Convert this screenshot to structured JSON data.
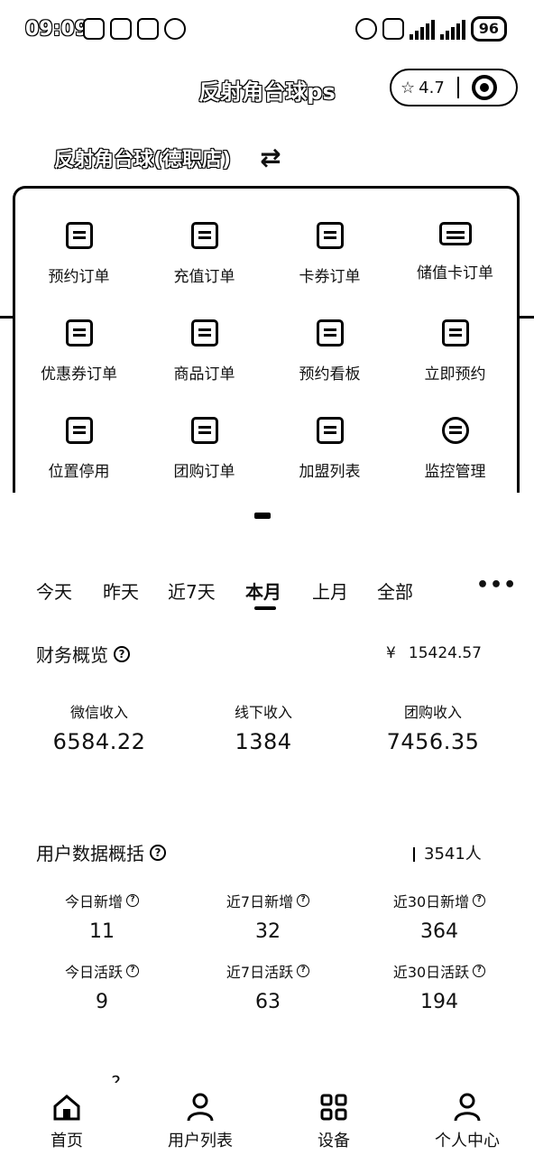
{
  "status_bar": {
    "time": "09:09",
    "battery": "96"
  },
  "header": {
    "title": "反射角台球ps",
    "rating": "4.7"
  },
  "store": {
    "name": "反射角台球(德职店)"
  },
  "grid": [
    {
      "label": "预约订单",
      "icon": "clipboard-icon"
    },
    {
      "label": "充值订单",
      "icon": "check-clipboard-icon"
    },
    {
      "label": "卡券订单",
      "icon": "ticket-icon"
    },
    {
      "label": "储值卡订单",
      "icon": "card-icon"
    },
    {
      "label": "优惠券订单",
      "icon": "coupon-icon"
    },
    {
      "label": "商品订单",
      "icon": "cart-icon"
    },
    {
      "label": "预约看板",
      "icon": "calendar-icon"
    },
    {
      "label": "立即预约",
      "icon": "booking-icon"
    },
    {
      "label": "位置停用",
      "icon": "location-off-icon"
    },
    {
      "label": "团购订单",
      "icon": "group-buy-icon"
    },
    {
      "label": "加盟列表",
      "icon": "franchise-icon"
    },
    {
      "label": "监控管理",
      "icon": "camera-icon"
    }
  ],
  "tabs": [
    "今天",
    "昨天",
    "近7天",
    "本月",
    "上月",
    "全部"
  ],
  "active_tab": "本月",
  "finance": {
    "title": "财务概览",
    "total": "15424.57",
    "currency": "¥",
    "metrics": [
      {
        "label": "微信收入",
        "value": "6584.22"
      },
      {
        "label": "线下收入",
        "value": "1384"
      },
      {
        "label": "团购收入",
        "value": "7456.35"
      }
    ]
  },
  "users": {
    "title": "用户数据概括",
    "total": "3541人",
    "stats": [
      {
        "label": "今日新增",
        "value": "11"
      },
      {
        "label": "近7日新增",
        "value": "32"
      },
      {
        "label": "近30日新增",
        "value": "364"
      },
      {
        "label": "今日活跃",
        "value": "9"
      },
      {
        "label": "近7日活跃",
        "value": "63"
      },
      {
        "label": "近30日活跃",
        "value": "194"
      }
    ]
  },
  "bottom_nav": [
    {
      "label": "首页",
      "icon": "home-icon"
    },
    {
      "label": "用户列表",
      "icon": "user-icon"
    },
    {
      "label": "设备",
      "icon": "grid-icon"
    },
    {
      "label": "个人中心",
      "icon": "profile-icon"
    }
  ]
}
